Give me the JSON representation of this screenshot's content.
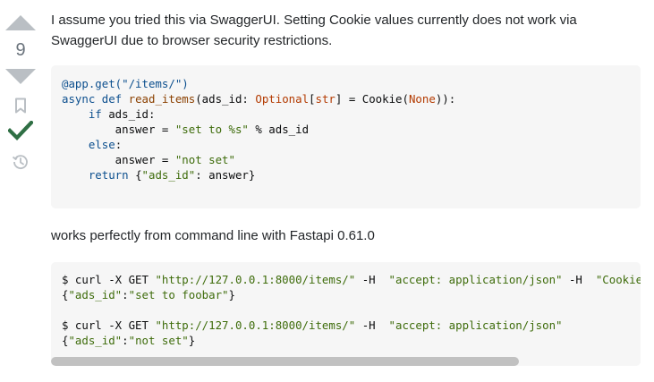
{
  "vote": {
    "count": "9"
  },
  "answer": {
    "intro": "I assume you tried this via SwaggerUI. Setting Cookie values currently does not work via SwaggerUI due to browser security restrictions.",
    "middle": "works perfectly from command line with Fastapi 0.61.0"
  },
  "code1": {
    "l1": "@app.get(\"/items/\")",
    "l2_kw": "async def",
    "l2_fn": "read_items",
    "l2_a": "(ads_id: ",
    "l2_type": "Optional",
    "l2_b": "[",
    "l2_str": "str",
    "l2_c": "] = Cookie(",
    "l2_none": "None",
    "l2_d": ")):",
    "l3_indent": "    ",
    "l3_kw": "if",
    "l3_rest": " ads_id:",
    "l4_a": "        answer = ",
    "l4_str": "\"set to %s\"",
    "l4_rest": " % ads_id",
    "l5_indent": "    ",
    "l5_kw": "else",
    "l5_rest": ":",
    "l6_a": "        answer = ",
    "l6_str": "\"not set\"",
    "l7_indent": "    ",
    "l7_kw": "return",
    "l7_a": " {",
    "l7_str": "\"ads_id\"",
    "l7_rest": ": answer}"
  },
  "code2": {
    "l1_a": "$ curl -X GET ",
    "l1_s1": "\"http://127.0.0.1:8000/items/\"",
    "l1_b": " -H  ",
    "l1_s2": "\"accept: application/json\"",
    "l1_c": " -H  ",
    "l1_s3": "\"Cookie: ads_id=foobar\"",
    "l2_a": "{",
    "l2_s1": "\"ads_id\"",
    "l2_b": ":",
    "l2_s2": "\"set to foobar\"",
    "l2_c": "}",
    "l4_a": "$ curl -X GET ",
    "l4_s1": "\"http://127.0.0.1:8000/items/\"",
    "l4_b": " -H  ",
    "l4_s2": "\"accept: application/json\"",
    "l5_a": "{",
    "l5_s1": "\"ads_id\"",
    "l5_b": ":",
    "l5_s2": "\"not set\"",
    "l5_c": "}"
  },
  "colors": {
    "vote_arrow": "#babfc4",
    "accepted_check": "#2f6f44",
    "icon_gray": "#babfc4",
    "code_bg": "#f6f6f6",
    "string": "#3e6c0b",
    "keyword": "#0c4f8e"
  },
  "icons": {
    "upvote": "upvote-arrow-icon",
    "downvote": "downvote-arrow-icon",
    "bookmark": "bookmark-icon",
    "accepted": "accepted-checkmark-icon",
    "history": "history-icon"
  },
  "scroll": {
    "thumb_fraction": 0.79
  }
}
